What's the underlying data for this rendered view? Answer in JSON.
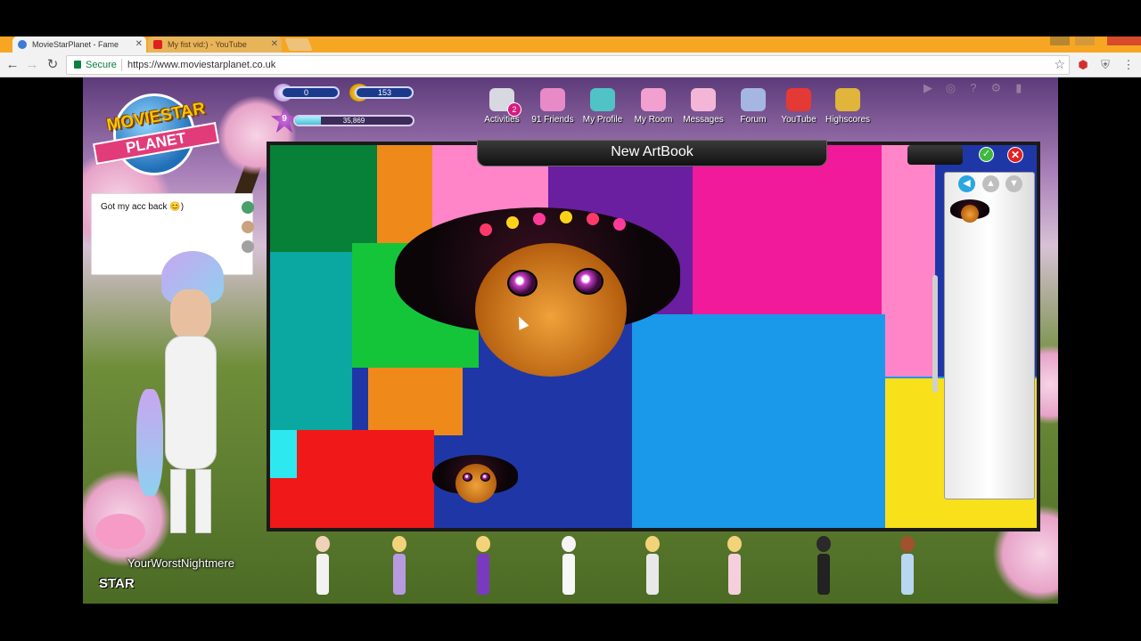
{
  "browser": {
    "tabs": [
      {
        "title": "MovieStarPlanet - Fame",
        "icon": "msp-favicon",
        "active": true
      },
      {
        "title": "My fist vid:) - YouTube",
        "icon": "youtube-favicon",
        "active": false
      }
    ],
    "address": {
      "secure_label": "Secure",
      "url": "https://www.moviestarplanet.co.uk"
    }
  },
  "game": {
    "logo": {
      "line1": "MOVIESTAR",
      "line2": "PLANET"
    },
    "stats": {
      "diamonds": "0",
      "coins": "153",
      "level": "9",
      "fame": "35,869",
      "fame_progress": 0.22
    },
    "menu": [
      {
        "label": "Activities",
        "badge": "2",
        "icon": "activities-icon",
        "color": "#d8d8e0"
      },
      {
        "label": "91 Friends",
        "badge": "",
        "icon": "friends-icon",
        "color": "#e98ac8"
      },
      {
        "label": "My Profile",
        "badge": "",
        "icon": "profile-icon",
        "color": "#4fc3c6"
      },
      {
        "label": "My Room",
        "badge": "",
        "icon": "room-icon",
        "color": "#f2a0d0"
      },
      {
        "label": "Messages",
        "badge": "",
        "icon": "messages-icon",
        "color": "#f3b6d6"
      },
      {
        "label": "Forum",
        "badge": "",
        "icon": "forum-icon",
        "color": "#a5b6e3"
      },
      {
        "label": "YouTube",
        "badge": "",
        "icon": "youtube-icon",
        "color": "#e53935"
      },
      {
        "label": "Highscores",
        "badge": "",
        "icon": "trophy-icon",
        "color": "#e0b53a"
      }
    ],
    "chat": {
      "text": "Got my acc back 😊)"
    },
    "player_name": "YourWorstNightmere",
    "star_label": "STAR",
    "artbook": {
      "title": "New ArtBook"
    }
  },
  "colors": {
    "tabbar": "#f6a623",
    "canvas_blue": "#1f37a6",
    "accent_pink": "#ff4fb8"
  }
}
